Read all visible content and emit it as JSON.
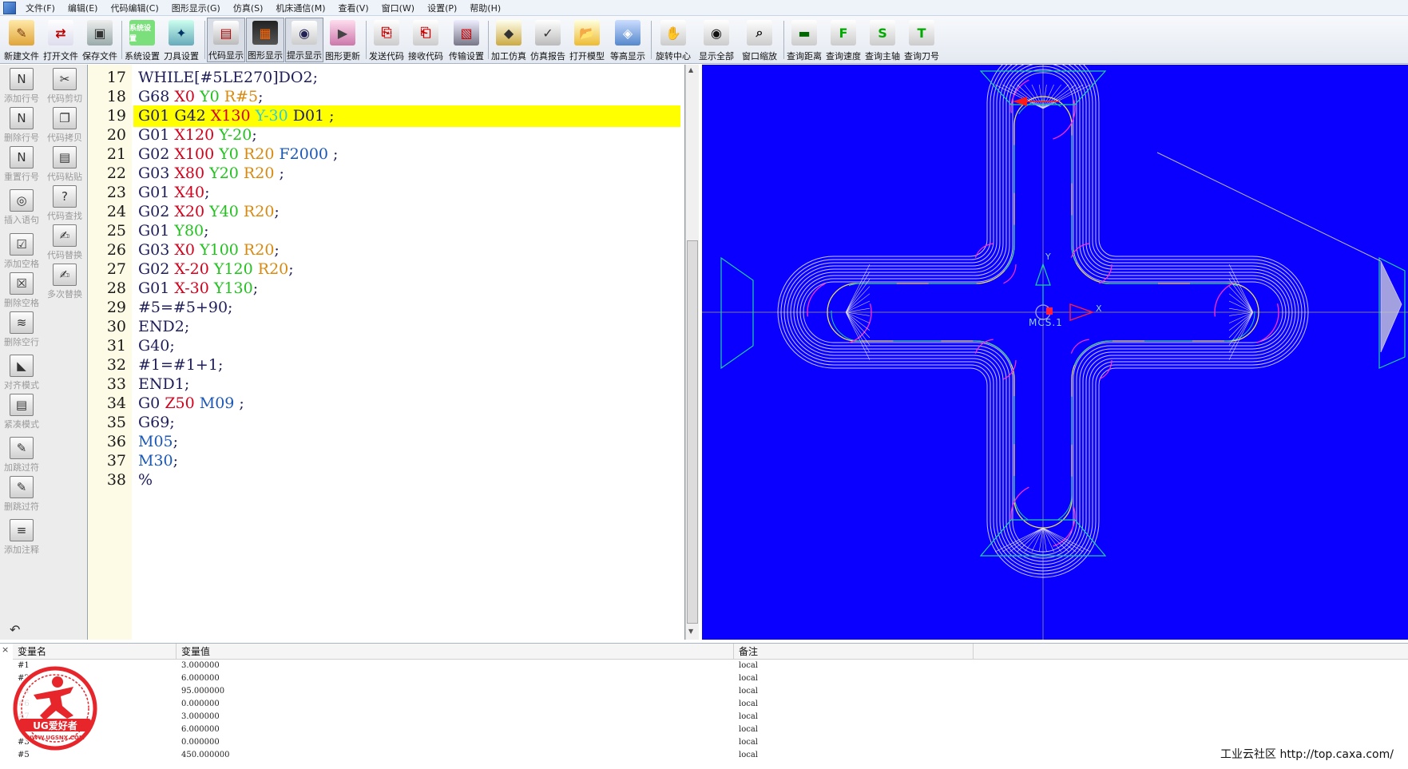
{
  "menu": [
    "文件(F)",
    "编辑(E)",
    "代码编辑(C)",
    "图形显示(G)",
    "仿真(S)",
    "机床通信(M)",
    "查看(V)",
    "窗口(W)",
    "设置(P)",
    "帮助(H)"
  ],
  "toolbar": {
    "buttons": [
      {
        "label": "新建文件",
        "icon": "pencil-icon"
      },
      {
        "label": "打开文件",
        "icon": "open-file-icon"
      },
      {
        "label": "保存文件",
        "icon": "save-file-icon"
      },
      {
        "label": "系统设置",
        "icon": "system-settings-icon",
        "icon_text": "系统设置"
      },
      {
        "label": "刀具设置",
        "icon": "tool-settings-icon"
      },
      {
        "label": "代码显示",
        "icon": "code-display-icon"
      },
      {
        "label": "图形显示",
        "icon": "graphic-display-icon"
      },
      {
        "label": "提示显示",
        "icon": "hint-display-icon"
      },
      {
        "label": "图形更新",
        "icon": "graphic-update-icon"
      },
      {
        "label": "发送代码",
        "icon": "send-code-icon"
      },
      {
        "label": "接收代码",
        "icon": "receive-code-icon"
      },
      {
        "label": "传输设置",
        "icon": "transfer-settings-icon"
      },
      {
        "label": "加工仿真",
        "icon": "machining-sim-icon"
      },
      {
        "label": "仿真报告",
        "icon": "sim-report-icon"
      },
      {
        "label": "打开模型",
        "icon": "open-model-icon"
      },
      {
        "label": "等高显示",
        "icon": "contour-display-icon"
      },
      {
        "label": "旋转中心",
        "icon": "rotate-center-icon"
      },
      {
        "label": "显示全部",
        "icon": "show-all-icon"
      },
      {
        "label": "窗口缩放",
        "icon": "window-zoom-icon"
      },
      {
        "label": "查询距离",
        "icon": "query-distance-icon"
      },
      {
        "label": "查询速度",
        "icon": "query-speed-icon",
        "icon_text": "F"
      },
      {
        "label": "查询主轴",
        "icon": "query-spindle-icon",
        "icon_text": "S"
      },
      {
        "label": "查询刀号",
        "icon": "query-tool-number-icon",
        "icon_text": "T"
      }
    ]
  },
  "sidebar": {
    "col1": [
      "添加行号",
      "删除行号",
      "重置行号",
      "插入语句",
      "添加空格",
      "删除空格",
      "删除空行",
      "对齐模式",
      "紧凑模式",
      "加跳过符",
      "删跳过符",
      "添加注释"
    ],
    "col2": [
      "代码剪切",
      "代码拷贝",
      "代码粘贴",
      "代码查找",
      "代码替换",
      "多次替换"
    ]
  },
  "editor": {
    "highlight_line": 19,
    "lines": [
      {
        "n": "17",
        "tokens": [
          [
            "w",
            "WHILE[#5LE270]DO2;"
          ]
        ]
      },
      {
        "n": "18",
        "tokens": [
          [
            "w",
            "G68 "
          ],
          [
            "r",
            "X0 "
          ],
          [
            "g",
            "Y0 "
          ],
          [
            "o",
            "R#5"
          ],
          [
            "w",
            ";"
          ]
        ]
      },
      {
        "n": "19",
        "tokens": [
          [
            "w",
            "G01 G42 "
          ],
          [
            "r",
            "X130 "
          ],
          [
            "c",
            "Y-30 "
          ],
          [
            "w",
            "D01 ;"
          ]
        ]
      },
      {
        "n": "20",
        "tokens": [
          [
            "w",
            "G01 "
          ],
          [
            "r",
            "X120 "
          ],
          [
            "g",
            "Y-20"
          ],
          [
            "w",
            ";"
          ]
        ]
      },
      {
        "n": "21",
        "tokens": [
          [
            "w",
            "G02 "
          ],
          [
            "r",
            "X100 "
          ],
          [
            "g",
            "Y0 "
          ],
          [
            "o",
            "R20 "
          ],
          [
            "b",
            "F2000"
          ],
          [
            "w",
            " ;"
          ]
        ]
      },
      {
        "n": "22",
        "tokens": [
          [
            "w",
            "G03 "
          ],
          [
            "r",
            "X80 "
          ],
          [
            "g",
            "Y20 "
          ],
          [
            "o",
            "R20"
          ],
          [
            "w",
            " ;"
          ]
        ]
      },
      {
        "n": "23",
        "tokens": [
          [
            "w",
            "G01 "
          ],
          [
            "r",
            "X40"
          ],
          [
            "w",
            ";"
          ]
        ]
      },
      {
        "n": "24",
        "tokens": [
          [
            "w",
            "G02 "
          ],
          [
            "r",
            "X20 "
          ],
          [
            "g",
            "Y40 "
          ],
          [
            "o",
            "R20"
          ],
          [
            "w",
            ";"
          ]
        ]
      },
      {
        "n": "25",
        "tokens": [
          [
            "w",
            "G01 "
          ],
          [
            "g",
            "Y80"
          ],
          [
            "w",
            ";"
          ]
        ]
      },
      {
        "n": "26",
        "tokens": [
          [
            "w",
            "G03 "
          ],
          [
            "r",
            "X0 "
          ],
          [
            "g",
            "Y100 "
          ],
          [
            "o",
            "R20"
          ],
          [
            "w",
            ";"
          ]
        ]
      },
      {
        "n": "27",
        "tokens": [
          [
            "w",
            "G02 "
          ],
          [
            "r",
            "X-20 "
          ],
          [
            "g",
            "Y120 "
          ],
          [
            "o",
            "R20"
          ],
          [
            "w",
            ";"
          ]
        ]
      },
      {
        "n": "28",
        "tokens": [
          [
            "w",
            "G01 "
          ],
          [
            "r",
            "X-30 "
          ],
          [
            "g",
            "Y130"
          ],
          [
            "w",
            ";"
          ]
        ]
      },
      {
        "n": "29",
        "tokens": [
          [
            "w",
            "#5=#5+90;"
          ]
        ]
      },
      {
        "n": "30",
        "tokens": [
          [
            "w",
            "END2;"
          ]
        ]
      },
      {
        "n": "31",
        "tokens": [
          [
            "w",
            "G40;"
          ]
        ]
      },
      {
        "n": "32",
        "tokens": [
          [
            "w",
            "#1=#1+1;"
          ]
        ]
      },
      {
        "n": "33",
        "tokens": [
          [
            "w",
            "END1;"
          ]
        ]
      },
      {
        "n": "34",
        "tokens": [
          [
            "w",
            "G0 "
          ],
          [
            "r",
            "Z50 "
          ],
          [
            "b",
            "M09"
          ],
          [
            "w",
            " ;"
          ]
        ]
      },
      {
        "n": "35",
        "tokens": [
          [
            "w",
            "G69;"
          ]
        ]
      },
      {
        "n": "36",
        "tokens": [
          [
            "b",
            "M05"
          ],
          [
            "w",
            ";"
          ]
        ]
      },
      {
        "n": "37",
        "tokens": [
          [
            "b",
            "M30"
          ],
          [
            "w",
            ";"
          ]
        ]
      },
      {
        "n": "38",
        "tokens": [
          [
            "w",
            "%"
          ]
        ]
      }
    ]
  },
  "graphics": {
    "axis_y": "Y",
    "axis_x": "X",
    "origin_label": "MCS.1",
    "background": "#0a00ff",
    "toolpath_color": "#e8e8f8",
    "contour_color": "#ff2fd2",
    "line_color": "#1fd0a0"
  },
  "variables": {
    "headers": [
      "变量名",
      "变量值",
      "备注"
    ],
    "rows": [
      {
        "name": "#1",
        "value": "3.000000",
        "note": "local"
      },
      {
        "name": "#2",
        "value": "6.000000",
        "note": "local"
      },
      {
        "name": "#4",
        "value": "95.000000",
        "note": "local"
      },
      {
        "name": "#6",
        "value": "0.000000",
        "note": "local"
      },
      {
        "name": "#7",
        "value": "3.000000",
        "note": "local"
      },
      {
        "name": "#8",
        "value": "6.000000",
        "note": "local"
      },
      {
        "name": "#3",
        "value": "0.000000",
        "note": "local"
      },
      {
        "name": "#5",
        "value": "450.000000",
        "note": "local"
      }
    ]
  },
  "watermark": {
    "text": "UG爱好者",
    "url": "WWW.UGSNX.COM"
  },
  "footer": "工业云社区 http://top.caxa.com/"
}
